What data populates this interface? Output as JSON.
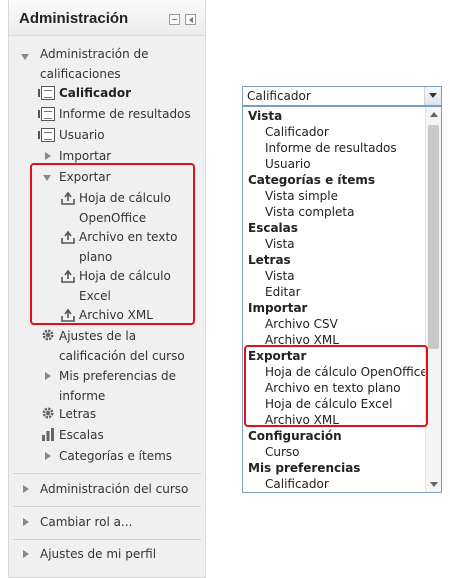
{
  "block": {
    "title": "Administración",
    "tree": {
      "grades_admin": "Administración de calificaciones",
      "grader": "Calificador",
      "results_report": "Informe de resultados",
      "user": "Usuario",
      "import": "Importar",
      "export": "Exportar",
      "export_items": [
        "Hoja de cálculo OpenOffice",
        "Archivo en texto plano",
        "Hoja de cálculo Excel",
        "Archivo XML"
      ],
      "course_grade_settings": "Ajustes de la calificación del curso",
      "my_report_prefs": "Mis preferencias de informe",
      "letters": "Letras",
      "scales": "Escalas",
      "categories_items": "Categorías e ítems"
    },
    "sections": [
      "Administración del curso",
      "Cambiar rol a...",
      "Ajustes de mi perfil"
    ]
  },
  "select": {
    "value": "Calificador",
    "options": [
      {
        "type": "group",
        "label": "Vista"
      },
      {
        "type": "item",
        "label": "Calificador"
      },
      {
        "type": "item",
        "label": "Informe de resultados"
      },
      {
        "type": "item",
        "label": "Usuario"
      },
      {
        "type": "group",
        "label": "Categorías e ítems"
      },
      {
        "type": "item",
        "label": "Vista simple"
      },
      {
        "type": "item",
        "label": "Vista completa"
      },
      {
        "type": "group",
        "label": "Escalas"
      },
      {
        "type": "item",
        "label": "Vista"
      },
      {
        "type": "group",
        "label": "Letras"
      },
      {
        "type": "item",
        "label": "Vista"
      },
      {
        "type": "item",
        "label": "Editar"
      },
      {
        "type": "group",
        "label": "Importar"
      },
      {
        "type": "item",
        "label": "Archivo CSV"
      },
      {
        "type": "item",
        "label": "Archivo XML"
      },
      {
        "type": "group",
        "label": "Exportar"
      },
      {
        "type": "item",
        "label": "Hoja de cálculo OpenOffice"
      },
      {
        "type": "item",
        "label": "Archivo en texto plano"
      },
      {
        "type": "item",
        "label": "Hoja de cálculo Excel"
      },
      {
        "type": "item",
        "label": "Archivo XML"
      },
      {
        "type": "group",
        "label": "Configuración"
      },
      {
        "type": "item",
        "label": "Curso"
      },
      {
        "type": "group",
        "label": "Mis preferencias"
      },
      {
        "type": "item",
        "label": "Calificador"
      }
    ]
  },
  "colors": {
    "highlight": "#e0101e",
    "panel_bg": "#f0f0f0",
    "select_border": "#7b9ebd"
  }
}
